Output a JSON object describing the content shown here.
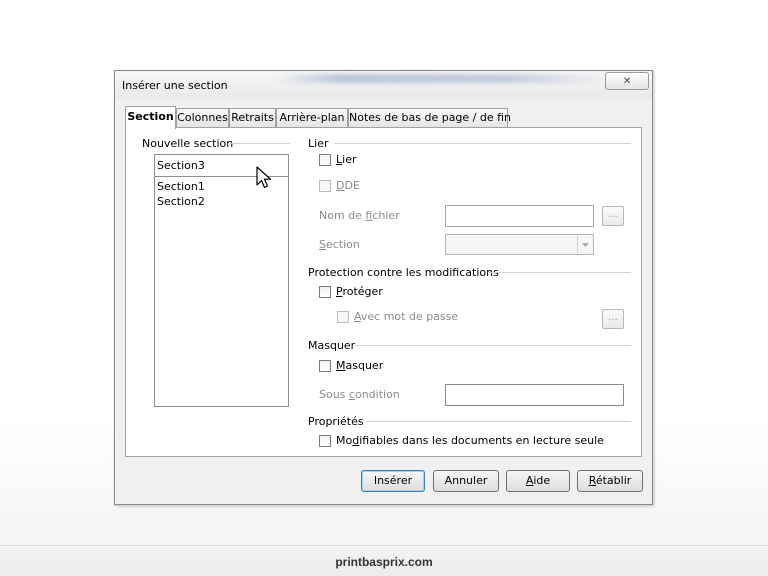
{
  "window": {
    "title": "Insérer une section",
    "close_glyph": "✕"
  },
  "tabs": [
    {
      "label": "Section",
      "active": true
    },
    {
      "label": "Colonnes",
      "active": false
    },
    {
      "label": "Retraits",
      "active": false
    },
    {
      "label": "Arrière-plan",
      "active": false
    },
    {
      "label": "Notes de bas de page / de fin",
      "active": false
    }
  ],
  "new_section": {
    "group_label": "Nouvelle section",
    "name_value": "Section3",
    "existing": [
      "Section1",
      "Section2"
    ]
  },
  "link": {
    "group_label": "Lier",
    "link_checkbox": {
      "pre": "",
      "mn": "L",
      "post": "ier",
      "checked": false
    },
    "dde_checkbox": {
      "pre": "",
      "mn": "D",
      "post": "DE",
      "checked": false,
      "enabled": false
    },
    "filename": {
      "pre": "Nom de ",
      "mn": "f",
      "post": "ichier",
      "value": ""
    },
    "section": {
      "pre": "",
      "mn": "S",
      "post": "ection",
      "value": ""
    },
    "browse_label": "..."
  },
  "protection": {
    "group_label": "Protection contre les modifications",
    "protect_checkbox": {
      "pre": "",
      "mn": "P",
      "post": "rotéger",
      "checked": false
    },
    "password_checkbox": {
      "pre": "",
      "mn": "A",
      "post": "vec mot de passe",
      "checked": false,
      "enabled": false
    },
    "password_button_label": "..."
  },
  "hide": {
    "group_label": "Masquer",
    "hide_checkbox": {
      "pre": "",
      "mn": "M",
      "post": "asquer",
      "checked": false
    },
    "condition": {
      "pre": "Sous ",
      "mn": "c",
      "post": "ondition",
      "value": ""
    }
  },
  "properties": {
    "group_label": "Propriétés",
    "editable_checkbox": {
      "pre": "Mo",
      "mn": "d",
      "post": "ifiables dans les documents en lecture seule",
      "checked": false
    }
  },
  "buttons": {
    "insert": {
      "pre": "Insérer",
      "mn": "",
      "post": ""
    },
    "cancel": {
      "pre": "Annuler",
      "mn": "",
      "post": ""
    },
    "help": {
      "pre": "",
      "mn": "A",
      "post": "ide"
    },
    "reset": {
      "pre": "",
      "mn": "R",
      "post": "établir"
    }
  },
  "footer": {
    "site": "printbasprix.com"
  },
  "colors": {
    "default_button_border": "#3c7fb1",
    "disabled_text": "#8c8c8c"
  }
}
